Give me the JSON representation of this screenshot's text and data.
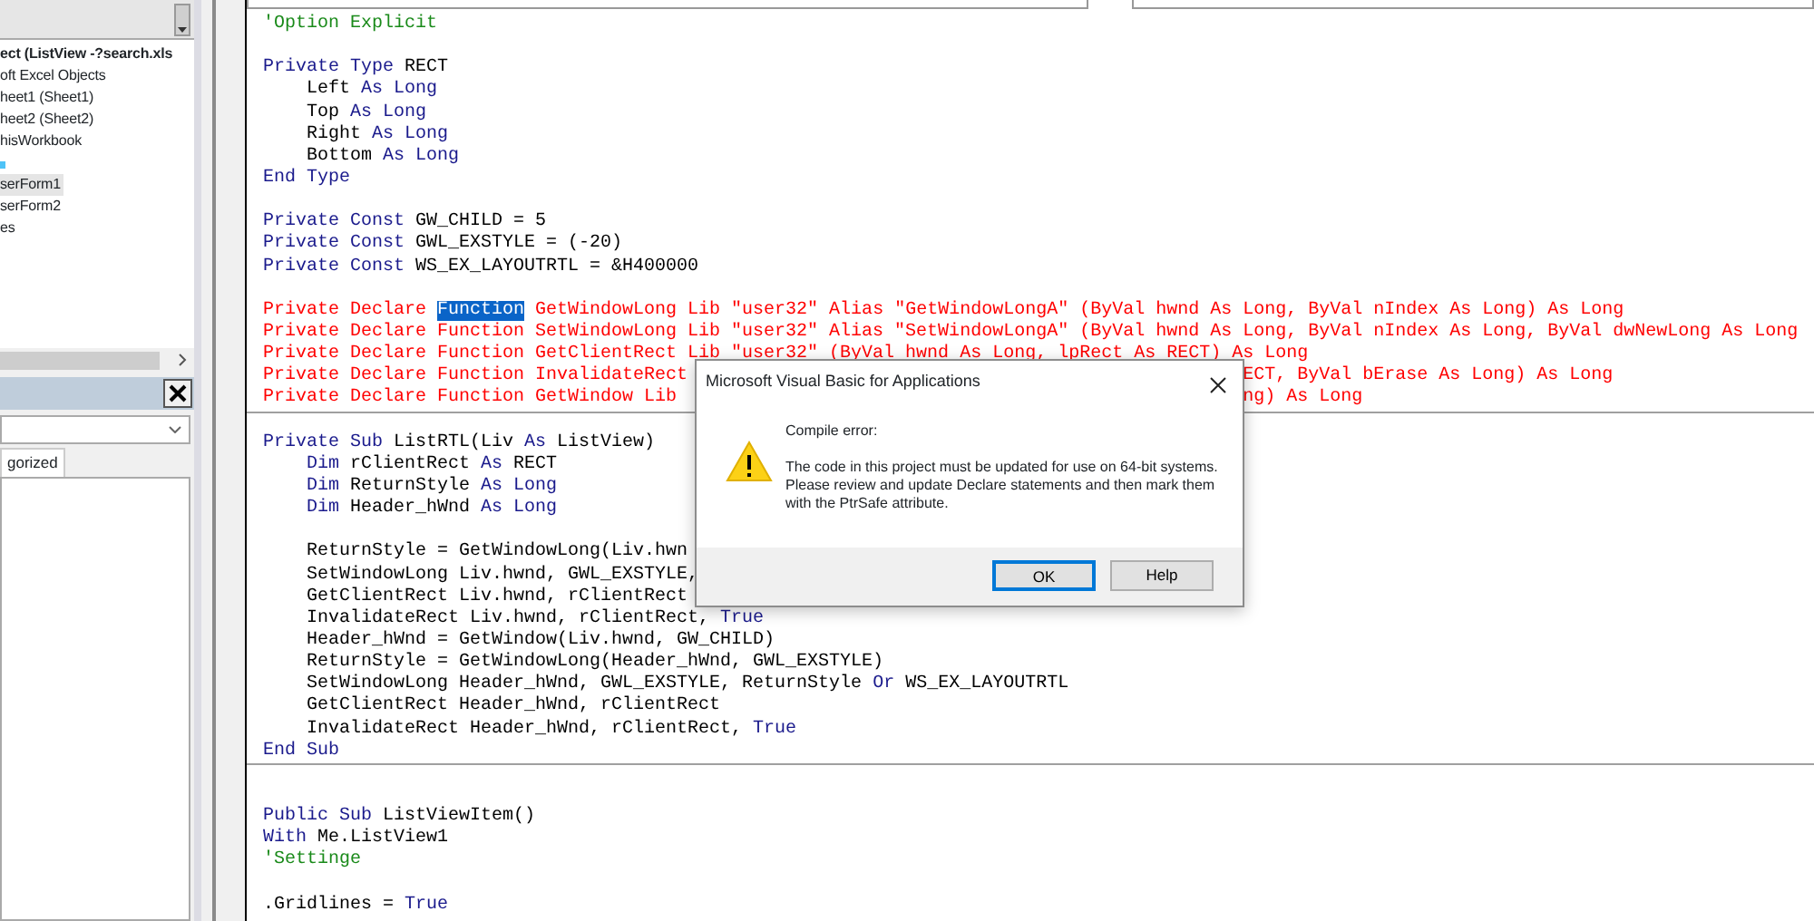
{
  "project_explorer": {
    "items": [
      {
        "label": "ect (ListView -?search.xls",
        "kind": "project",
        "selected": false
      },
      {
        "label": "oft Excel Objects",
        "kind": "item",
        "selected": false
      },
      {
        "label": "heet1 (Sheet1)",
        "kind": "item",
        "selected": false
      },
      {
        "label": "heet2 (Sheet2)",
        "kind": "item",
        "selected": false
      },
      {
        "label": "hisWorkbook",
        "kind": "item",
        "selected": false
      },
      {
        "kind": "icon",
        "selected": false
      },
      {
        "label": "serForm1",
        "kind": "item",
        "selected": true
      },
      {
        "label": "serForm2",
        "kind": "item",
        "selected": false
      },
      {
        "label": "es",
        "kind": "item",
        "selected": false
      }
    ]
  },
  "properties": {
    "tabs": [
      {
        "label": "gorized",
        "selected": true
      }
    ]
  },
  "code_lines": [
    {
      "kind": "code",
      "segments": [
        {
          "text": "'Option Explicit",
          "kind": "comment"
        }
      ]
    },
    {
      "kind": "blank"
    },
    {
      "kind": "code",
      "segments": [
        {
          "text": "Private Type",
          "kind": "keyword"
        },
        {
          "text": " RECT",
          "kind": "plain"
        }
      ]
    },
    {
      "kind": "code",
      "segments": [
        {
          "text": "    Left",
          "kind": "plain"
        },
        {
          "text": " As Long",
          "kind": "keyword"
        }
      ]
    },
    {
      "kind": "code",
      "segments": [
        {
          "text": "    Top",
          "kind": "plain"
        },
        {
          "text": " As Long",
          "kind": "keyword"
        }
      ]
    },
    {
      "kind": "code",
      "segments": [
        {
          "text": "    Right",
          "kind": "plain"
        },
        {
          "text": " As Long",
          "kind": "keyword"
        }
      ]
    },
    {
      "kind": "code",
      "segments": [
        {
          "text": "    Bottom",
          "kind": "plain"
        },
        {
          "text": " As Long",
          "kind": "keyword"
        }
      ]
    },
    {
      "kind": "code",
      "segments": [
        {
          "text": "End Type",
          "kind": "keyword"
        }
      ]
    },
    {
      "kind": "blank"
    },
    {
      "kind": "code",
      "segments": [
        {
          "text": "Private Const",
          "kind": "keyword"
        },
        {
          "text": " GW_CHILD = 5",
          "kind": "plain"
        }
      ]
    },
    {
      "kind": "code",
      "segments": [
        {
          "text": "Private Const",
          "kind": "keyword"
        },
        {
          "text": " GWL_EXSTYLE = (-20)",
          "kind": "plain"
        }
      ]
    },
    {
      "kind": "code",
      "segments": [
        {
          "text": "Private Const",
          "kind": "keyword"
        },
        {
          "text": " WS_EX_LAYOUTRTL = &H400000",
          "kind": "plain"
        }
      ]
    },
    {
      "kind": "blank"
    },
    {
      "kind": "code",
      "segments": [
        {
          "text": "Private Declare ",
          "kind": "error"
        },
        {
          "text": "Function",
          "kind": "selected"
        },
        {
          "text": " GetWindowLong Lib \"user32\" Alias \"GetWindowLongA\" (ByVal hwnd As Long, ByVal nIndex As Long) As Long",
          "kind": "error"
        }
      ]
    },
    {
      "kind": "code",
      "segments": [
        {
          "text": "Private Declare Function SetWindowLong Lib \"user32\" Alias \"SetWindowLongA\" (ByVal hwnd As Long, ByVal nIndex As Long, ByVal dwNewLong As Long",
          "kind": "error"
        }
      ]
    },
    {
      "kind": "code",
      "segments": [
        {
          "text": "Private Declare Function GetClientRect Lib \"user32\" (ByVal hwnd As Long, lpRect As RECT) As Long",
          "kind": "error"
        }
      ]
    },
    {
      "kind": "code",
      "segments": [
        {
          "text": "Private Declare Function InvalidateRect",
          "kind": "error"
        }
      ],
      "after_dialog": [
        {
          "text": "ECT, ByVal bErase As Long) As Long",
          "kind": "error"
        }
      ]
    },
    {
      "kind": "code",
      "segments": [
        {
          "text": "Private Declare Function GetWindow Lib",
          "kind": "error"
        }
      ],
      "after_dialog": [
        {
          "text": "ng) As Long",
          "kind": "error"
        }
      ]
    },
    {
      "kind": "blank",
      "separator": true
    },
    {
      "kind": "code",
      "segments": [
        {
          "text": "Private Sub",
          "kind": "keyword"
        },
        {
          "text": " ListRTL(Liv",
          "kind": "plain"
        },
        {
          "text": " As",
          "kind": "keyword"
        },
        {
          "text": " ListView)",
          "kind": "plain"
        }
      ]
    },
    {
      "kind": "code",
      "segments": [
        {
          "text": "    Dim",
          "kind": "keyword"
        },
        {
          "text": " rClientRect",
          "kind": "plain"
        },
        {
          "text": " As",
          "kind": "keyword"
        },
        {
          "text": " RECT",
          "kind": "plain"
        }
      ]
    },
    {
      "kind": "code",
      "segments": [
        {
          "text": "    Dim",
          "kind": "keyword"
        },
        {
          "text": " ReturnStyle",
          "kind": "plain"
        },
        {
          "text": " As Long",
          "kind": "keyword"
        }
      ]
    },
    {
      "kind": "code",
      "segments": [
        {
          "text": "    Dim",
          "kind": "keyword"
        },
        {
          "text": " Header_hWnd",
          "kind": "plain"
        },
        {
          "text": " As Long",
          "kind": "keyword"
        }
      ]
    },
    {
      "kind": "blank"
    },
    {
      "kind": "code",
      "segments": [
        {
          "text": "    ReturnStyle = GetWindowLong(Liv.hwn",
          "kind": "plain"
        }
      ]
    },
    {
      "kind": "code",
      "segments": [
        {
          "text": "    SetWindowLong Liv.hwnd, GWL_EXSTYLE,",
          "kind": "plain"
        }
      ]
    },
    {
      "kind": "code",
      "segments": [
        {
          "text": "    GetClientRect Liv.hwnd, rClientRect",
          "kind": "plain"
        }
      ]
    },
    {
      "kind": "code",
      "segments": [
        {
          "text": "    InvalidateRect Liv.hwnd, rClientRect, ",
          "kind": "plain"
        },
        {
          "text": "True",
          "kind": "keyword"
        }
      ]
    },
    {
      "kind": "code",
      "segments": [
        {
          "text": "    Header_hWnd = GetWindow(Liv.hwnd, GW_CHILD)",
          "kind": "plain"
        }
      ]
    },
    {
      "kind": "code",
      "segments": [
        {
          "text": "    ReturnStyle = GetWindowLong(Header_hWnd, GWL_EXSTYLE)",
          "kind": "plain"
        }
      ]
    },
    {
      "kind": "code",
      "segments": [
        {
          "text": "    SetWindowLong Header_hWnd, GWL_EXSTYLE, ReturnStyle ",
          "kind": "plain"
        },
        {
          "text": "Or",
          "kind": "keyword"
        },
        {
          "text": " WS_EX_LAYOUTRTL",
          "kind": "plain"
        }
      ]
    },
    {
      "kind": "code",
      "segments": [
        {
          "text": "    GetClientRect Header_hWnd, rClientRect",
          "kind": "plain"
        }
      ]
    },
    {
      "kind": "code",
      "segments": [
        {
          "text": "    InvalidateRect Header_hWnd, rClientRect, ",
          "kind": "plain"
        },
        {
          "text": "True",
          "kind": "keyword"
        }
      ]
    },
    {
      "kind": "code",
      "segments": [
        {
          "text": "End Sub",
          "kind": "keyword"
        }
      ]
    },
    {
      "kind": "blank",
      "separator": true
    },
    {
      "kind": "blank"
    },
    {
      "kind": "code",
      "segments": [
        {
          "text": "Public Sub",
          "kind": "keyword"
        },
        {
          "text": " ListViewItem()",
          "kind": "plain"
        }
      ]
    },
    {
      "kind": "code",
      "segments": [
        {
          "text": "With",
          "kind": "keyword"
        },
        {
          "text": " Me.ListView1",
          "kind": "plain"
        }
      ]
    },
    {
      "kind": "code",
      "segments": [
        {
          "text": "'Settinge",
          "kind": "comment"
        }
      ]
    },
    {
      "kind": "blank"
    },
    {
      "kind": "code",
      "segments": [
        {
          "text": ".Gridlines = ",
          "kind": "plain"
        },
        {
          "text": "True",
          "kind": "keyword"
        }
      ]
    }
  ],
  "dialog": {
    "title": "Microsoft Visual Basic for Applications",
    "heading": "Compile error:",
    "message": "The code in this project must be updated for use on 64-bit systems.  Please review and update Declare statements and then mark them with the PtrSafe attribute.",
    "buttons": [
      {
        "label": "OK",
        "selected": true
      },
      {
        "label": "Help",
        "selected": false
      }
    ]
  }
}
